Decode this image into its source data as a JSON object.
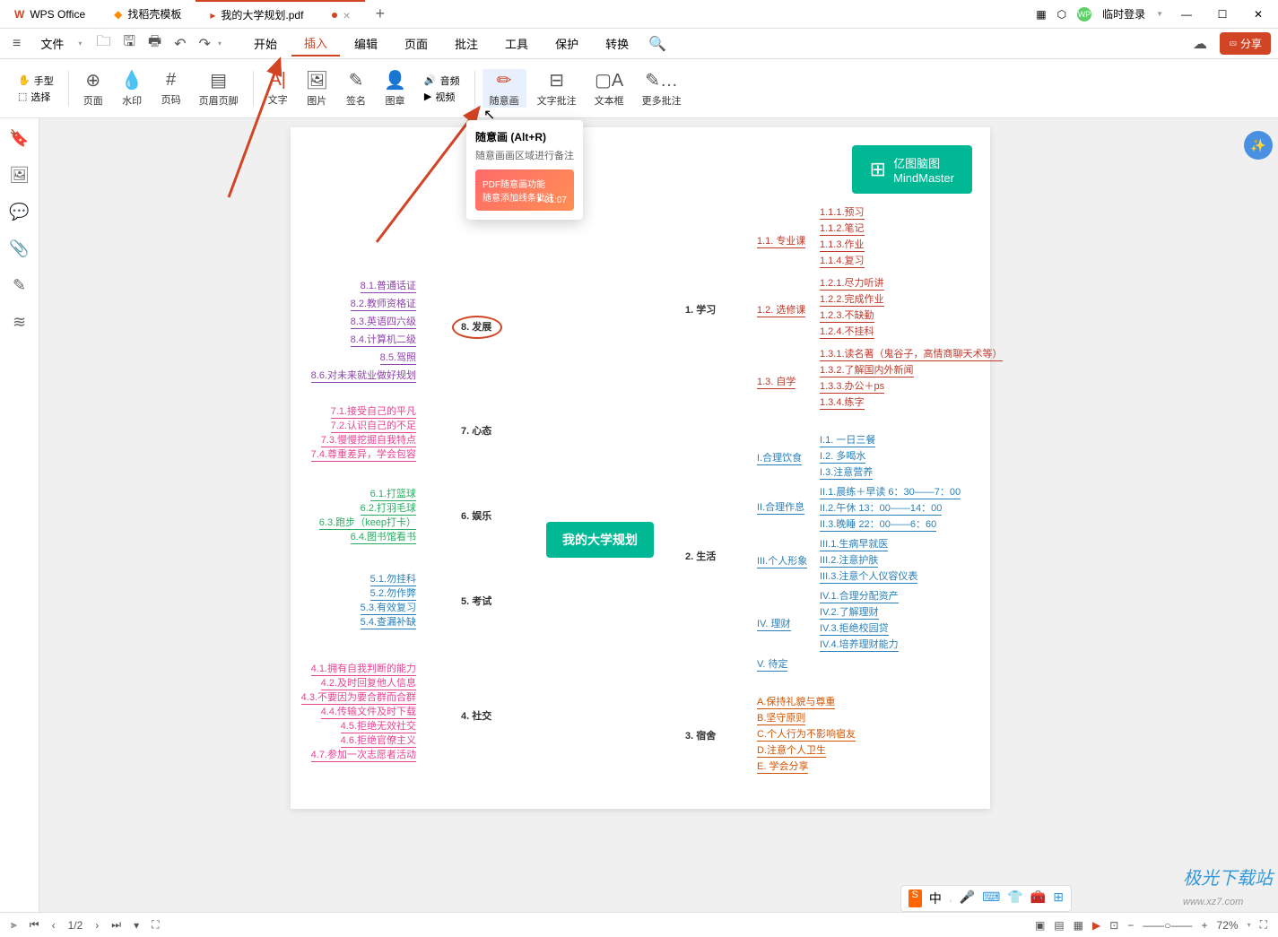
{
  "titlebar": {
    "app_name": "WPS Office",
    "tab_template": "找稻壳模板",
    "tab_active": "我的大学规划.pdf",
    "login": "临时登录"
  },
  "menubar": {
    "file": "文件",
    "start": "开始",
    "insert": "插入",
    "edit": "编辑",
    "page": "页面",
    "annotate": "批注",
    "tools": "工具",
    "protect": "保护",
    "convert": "转换"
  },
  "menubar_right": {
    "share": "分享"
  },
  "ribbon": {
    "hand": "手型",
    "select": "选择",
    "page": "页面",
    "watermark": "水印",
    "pagenum": "页码",
    "headerfooter": "页眉页脚",
    "text": "文字",
    "image": "图片",
    "signature": "签名",
    "stamp": "图章",
    "audio": "音频",
    "video": "视频",
    "freedraw": "随意画",
    "textannot": "文字批注",
    "textbox": "文本框",
    "moreannot": "更多批注"
  },
  "tooltip": {
    "title": "随意画 (Alt+R)",
    "desc": "随意画画区域进行备注",
    "video_line1": "PDF随意画功能",
    "video_line2": "随意添加线条批注",
    "video_time": "01:07"
  },
  "mindmap": {
    "logo_cn": "亿图脑图",
    "logo_en": "MindMaster",
    "center": "我的大学规划",
    "b1": {
      "label": "1. 学习",
      "c1": {
        "label": "1.1. 专业课",
        "items": [
          "1.1.1.预习",
          "1.1.2.笔记",
          "1.1.3.作业",
          "1.1.4.复习"
        ]
      },
      "c2": {
        "label": "1.2. 选修课",
        "items": [
          "1.2.1.尽力听讲",
          "1.2.2.完成作业",
          "1.2.3.不缺勤",
          "1.2.4.不挂科"
        ]
      },
      "c3": {
        "label": "1.3. 自学",
        "items": [
          "1.3.1.读名著（鬼谷子，高情商聊天术等）",
          "1.3.2.了解国内外新闻",
          "1.3.3.办公＋ps",
          "1.3.4.练字"
        ]
      }
    },
    "b2": {
      "label": "2. 生活",
      "c1": {
        "label": "I.合理饮食",
        "items": [
          "I.1. 一日三餐",
          "I.2. 多喝水",
          "I.3.注意营养"
        ]
      },
      "c2": {
        "label": "II.合理作息",
        "items": [
          "II.1.晨练＋早读 6：30——7：00",
          "II.2.午休 13：00——14：00",
          "II.3.晚睡 22：00——6：60"
        ]
      },
      "c3": {
        "label": "III.个人形象",
        "items": [
          "III.1.生病早就医",
          "III.2.注意护肤",
          "III.3.注意个人仪容仪表"
        ]
      },
      "c4": {
        "label": "IV. 理财",
        "items": [
          "IV.1.合理分配资产",
          "IV.2.了解理财",
          "IV.3.拒绝校园贷",
          "IV.4.培养理财能力"
        ]
      },
      "c5": {
        "label": "V. 待定"
      }
    },
    "b3": {
      "label": "3. 宿舍",
      "items": [
        "A.保持礼貌与尊重",
        "B.坚守原则",
        "C.个人行为不影响宿友",
        "D.注意个人卫生",
        "E. 学会分享"
      ]
    },
    "b4": {
      "label": "4. 社交",
      "items": [
        "4.1.拥有自我判断的能力",
        "4.2.及时回复他人信息",
        "4.3.不要因为要合群而合群",
        "4.4.传输文件及时下载",
        "4.5.拒绝无效社交",
        "4.6.拒绝官僚主义",
        "4.7.参加一次志愿者活动"
      ]
    },
    "b5": {
      "label": "5. 考试",
      "items": [
        "5.1.勿挂科",
        "5.2.勿作弊",
        "5.3.有效复习",
        "5.4.查漏补缺"
      ]
    },
    "b6": {
      "label": "6. 娱乐",
      "items": [
        "6.1.打篮球",
        "6.2.打羽毛球",
        "6.3.跑步（keep打卡）",
        "6.4.图书馆看书"
      ]
    },
    "b7": {
      "label": "7. 心态",
      "items": [
        "7.1.接受自己的平凡",
        "7.2.认识自己的不足",
        "7.3.慢慢挖掘自我特点",
        "7.4.尊重差异，学会包容"
      ]
    },
    "b8": {
      "label": "8. 发展",
      "items": [
        "8.1.普通话证",
        "8.2.教师资格证",
        "8.3.英语四六级",
        "8.4.计算机二级",
        "8.5.驾照",
        "8.6.对未来就业做好规划"
      ]
    }
  },
  "statusbar": {
    "page": "1/2",
    "zoom": "72%"
  },
  "watermark": {
    "brand": "极光下载站",
    "url": "www.xz7.com"
  },
  "sogou": {
    "char": "中"
  }
}
